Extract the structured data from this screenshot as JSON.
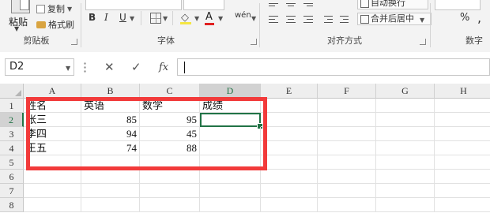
{
  "ribbon": {
    "clipboard": {
      "paste_label": "粘贴",
      "copy_label": "复制",
      "format_painter_label": "格式刷",
      "group_label": "剪贴板"
    },
    "font": {
      "bold": "B",
      "italic": "I",
      "underline": "U",
      "font_color_letter": "A",
      "phonetic": "wén",
      "group_label": "字体"
    },
    "alignment": {
      "wrap_text_label": "自动换行",
      "merge_center_label": "合并后居中",
      "group_label": "对齐方式"
    },
    "number": {
      "percent": "%",
      "comma": ",",
      "group_label": "数字"
    }
  },
  "formula_bar": {
    "name_box": "D2",
    "cancel": "✕",
    "enter": "✓",
    "fx": "fx",
    "value": ""
  },
  "grid": {
    "columns": [
      "A",
      "B",
      "C",
      "D",
      "E",
      "F",
      "G",
      "H"
    ],
    "rows": [
      "1",
      "2",
      "3",
      "4",
      "5",
      "6",
      "7",
      "8"
    ],
    "header_row": {
      "A": "姓名",
      "B": "英语",
      "C": "数学",
      "D": "成绩"
    },
    "data": [
      {
        "A": "张三",
        "B": "85",
        "C": "95",
        "D": ""
      },
      {
        "A": "李四",
        "B": "94",
        "C": "45",
        "D": ""
      },
      {
        "A": "王五",
        "B": "74",
        "C": "88",
        "D": ""
      }
    ],
    "selected_cell": "D2"
  },
  "colors": {
    "accent_green": "#217346",
    "highlight_red": "#f23a3a"
  }
}
